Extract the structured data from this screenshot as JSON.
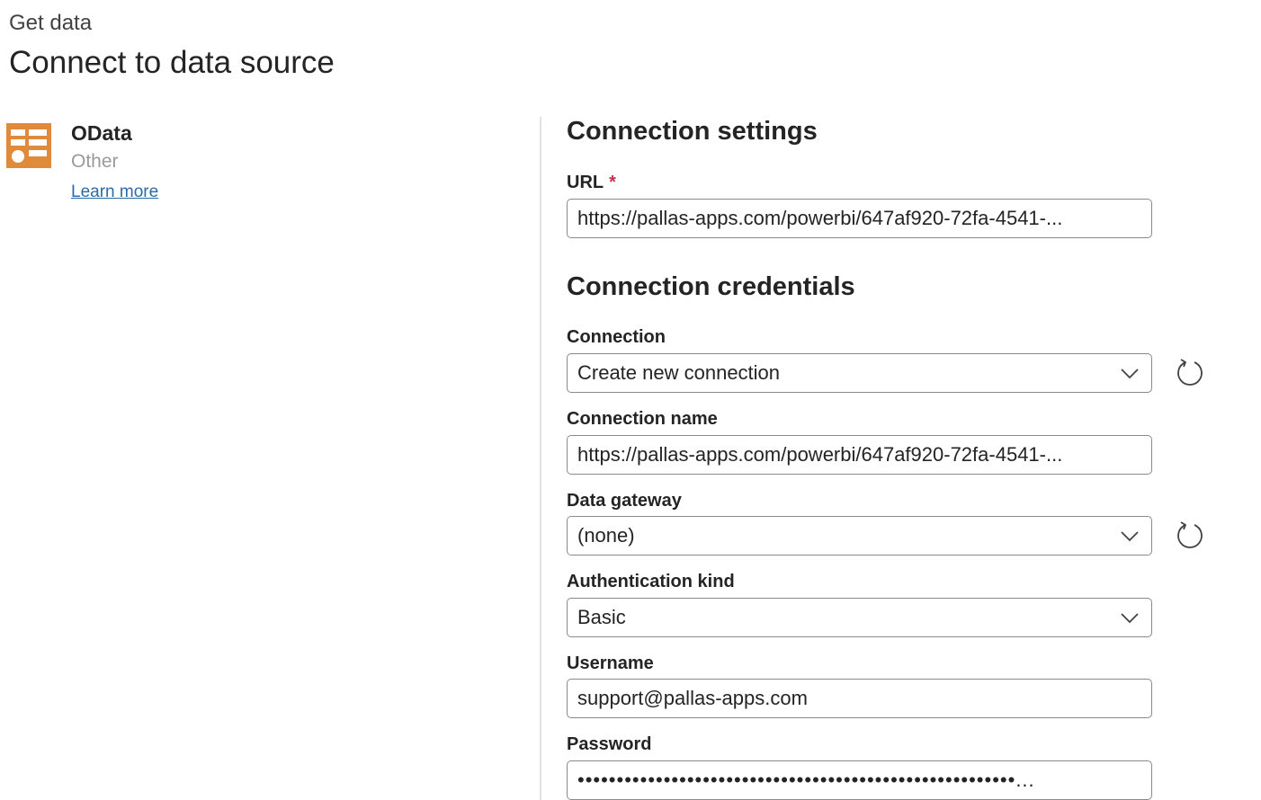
{
  "header": {
    "breadcrumb": "Get data",
    "title": "Connect to data source"
  },
  "connector": {
    "name": "OData",
    "category": "Other",
    "learn_more": "Learn more",
    "icon": "odata-table-icon",
    "icon_color": "#e08a3c"
  },
  "connection_settings": {
    "title": "Connection settings",
    "url_label": "URL",
    "required_marker": "*",
    "url_value": "https://pallas-apps.com/powerbi/647af920-72fa-4541-..."
  },
  "connection_credentials": {
    "title": "Connection credentials",
    "connection_label": "Connection",
    "connection_value": "Create new connection",
    "connection_name_label": "Connection name",
    "connection_name_value": "https://pallas-apps.com/powerbi/647af920-72fa-4541-...",
    "gateway_label": "Data gateway",
    "gateway_value": "(none)",
    "auth_label": "Authentication kind",
    "auth_value": "Basic",
    "username_label": "Username",
    "username_value": "support@pallas-apps.com",
    "password_label": "Password",
    "password_value": "••••••••••••••••••••••••••••••••••••••••••••••••••••••••..."
  },
  "colors": {
    "required": "#c4314b",
    "link": "#2b6ca8",
    "border": "#8a8a8a"
  }
}
